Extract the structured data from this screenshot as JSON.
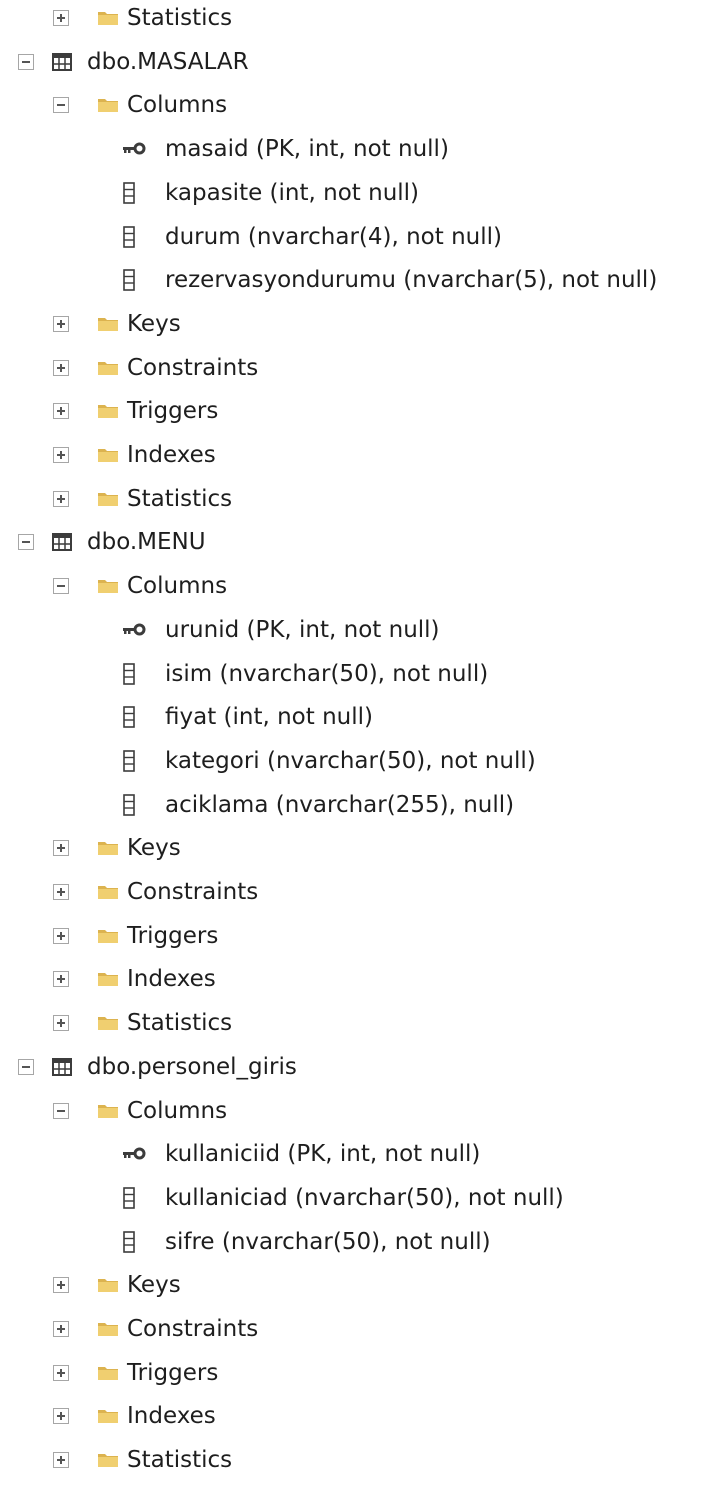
{
  "colors": {
    "folder": "#dcb34f",
    "folder_light": "#f0cf70",
    "text": "#1e1e1e",
    "toggle_border": "#a6a6a6",
    "icon_dark": "#3c3c3c"
  },
  "rows": [
    {
      "level": 1,
      "kind": "folder",
      "toggle": "expand",
      "label": "Statistics"
    },
    {
      "level": 0,
      "kind": "table",
      "toggle": "collapse",
      "label": "dbo.MASALAR"
    },
    {
      "level": 1,
      "kind": "folder",
      "toggle": "collapse",
      "label": "Columns"
    },
    {
      "level": 2,
      "kind": "key",
      "toggle": "none",
      "label": "masaid (PK, int, not null)"
    },
    {
      "level": 2,
      "kind": "column",
      "toggle": "none",
      "label": "kapasite (int, not null)"
    },
    {
      "level": 2,
      "kind": "column",
      "toggle": "none",
      "label": "durum (nvarchar(4), not null)"
    },
    {
      "level": 2,
      "kind": "column",
      "toggle": "none",
      "label": "rezervasyondurumu (nvarchar(5), not null)"
    },
    {
      "level": 1,
      "kind": "folder",
      "toggle": "expand",
      "label": "Keys"
    },
    {
      "level": 1,
      "kind": "folder",
      "toggle": "expand",
      "label": "Constraints"
    },
    {
      "level": 1,
      "kind": "folder",
      "toggle": "expand",
      "label": "Triggers"
    },
    {
      "level": 1,
      "kind": "folder",
      "toggle": "expand",
      "label": "Indexes"
    },
    {
      "level": 1,
      "kind": "folder",
      "toggle": "expand",
      "label": "Statistics"
    },
    {
      "level": 0,
      "kind": "table",
      "toggle": "collapse",
      "label": "dbo.MENU"
    },
    {
      "level": 1,
      "kind": "folder",
      "toggle": "collapse",
      "label": "Columns"
    },
    {
      "level": 2,
      "kind": "key",
      "toggle": "none",
      "label": "urunid (PK, int, not null)"
    },
    {
      "level": 2,
      "kind": "column",
      "toggle": "none",
      "label": "isim (nvarchar(50), not null)"
    },
    {
      "level": 2,
      "kind": "column",
      "toggle": "none",
      "label": "fiyat (int, not null)"
    },
    {
      "level": 2,
      "kind": "column",
      "toggle": "none",
      "label": "kategori (nvarchar(50), not null)"
    },
    {
      "level": 2,
      "kind": "column",
      "toggle": "none",
      "label": "aciklama (nvarchar(255), null)"
    },
    {
      "level": 1,
      "kind": "folder",
      "toggle": "expand",
      "label": "Keys"
    },
    {
      "level": 1,
      "kind": "folder",
      "toggle": "expand",
      "label": "Constraints"
    },
    {
      "level": 1,
      "kind": "folder",
      "toggle": "expand",
      "label": "Triggers"
    },
    {
      "level": 1,
      "kind": "folder",
      "toggle": "expand",
      "label": "Indexes"
    },
    {
      "level": 1,
      "kind": "folder",
      "toggle": "expand",
      "label": "Statistics"
    },
    {
      "level": 0,
      "kind": "table",
      "toggle": "collapse",
      "label": "dbo.personel_giris"
    },
    {
      "level": 1,
      "kind": "folder",
      "toggle": "collapse",
      "label": "Columns"
    },
    {
      "level": 2,
      "kind": "key",
      "toggle": "none",
      "label": "kullaniciid (PK, int, not null)"
    },
    {
      "level": 2,
      "kind": "column",
      "toggle": "none",
      "label": "kullaniciad (nvarchar(50), not null)"
    },
    {
      "level": 2,
      "kind": "column",
      "toggle": "none",
      "label": "sifre (nvarchar(50), not null)"
    },
    {
      "level": 1,
      "kind": "folder",
      "toggle": "expand",
      "label": "Keys"
    },
    {
      "level": 1,
      "kind": "folder",
      "toggle": "expand",
      "label": "Constraints"
    },
    {
      "level": 1,
      "kind": "folder",
      "toggle": "expand",
      "label": "Triggers"
    },
    {
      "level": 1,
      "kind": "folder",
      "toggle": "expand",
      "label": "Indexes"
    },
    {
      "level": 1,
      "kind": "folder",
      "toggle": "expand",
      "label": "Statistics"
    }
  ]
}
